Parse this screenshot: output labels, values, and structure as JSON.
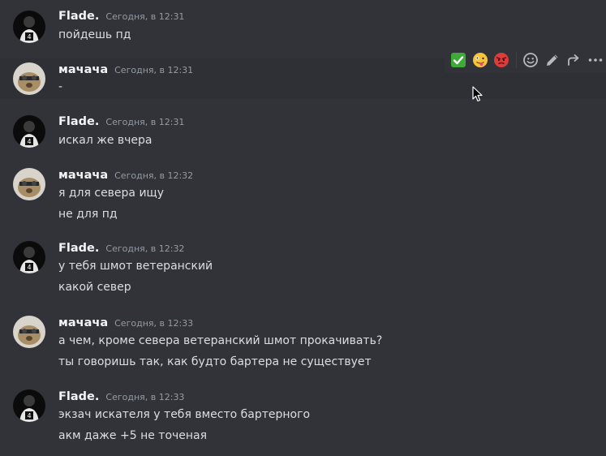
{
  "messages": [
    {
      "author": "Flade.",
      "time": "Сегодня, в 12:31",
      "lines": [
        "пойдешь пд"
      ]
    },
    {
      "author": "мачача",
      "time": "Сегодня, в 12:31",
      "lines": [
        "-"
      ]
    },
    {
      "author": "Flade.",
      "time": "Сегодня, в 12:31",
      "lines": [
        "искал же вчера"
      ]
    },
    {
      "author": "мачача",
      "time": "Сегодня, в 12:32",
      "lines": [
        "я для севера ищу",
        "не для пд"
      ]
    },
    {
      "author": "Flade.",
      "time": "Сегодня, в 12:32",
      "lines": [
        "у тебя шмот ветеранский",
        "какой север"
      ]
    },
    {
      "author": "мачача",
      "time": "Сегодня, в 12:33",
      "lines": [
        "а чем, кроме севера ветеранский шмот прокачивать?",
        "ты говоришь так, как будто бартера не существует"
      ]
    },
    {
      "author": "Flade.",
      "time": "Сегодня, в 12:33",
      "lines": [
        "экзач искателя у тебя вместо бартерного",
        "акм даже +5 не точеная"
      ]
    }
  ],
  "toolbar": {
    "buttons": [
      "check-mark-reaction",
      "zany-face-reaction",
      "angry-face-reaction",
      "add-reaction-icon",
      "edit-icon",
      "forward-icon",
      "more-icon"
    ]
  }
}
